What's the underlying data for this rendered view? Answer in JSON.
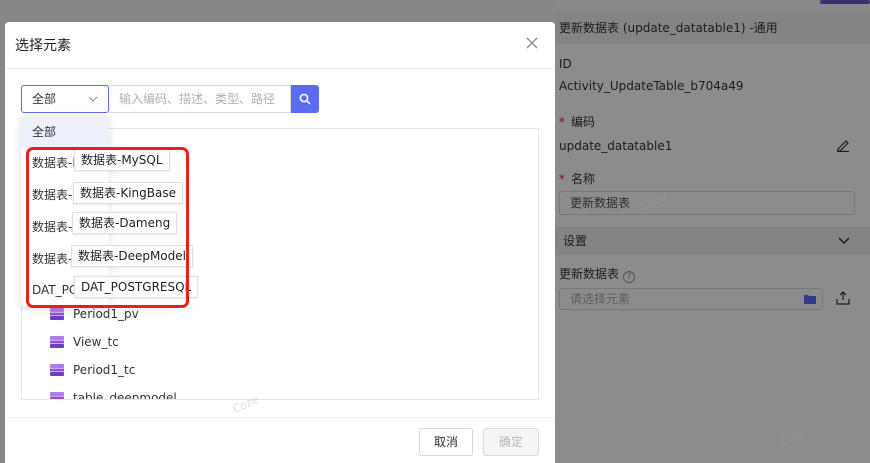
{
  "right_panel": {
    "header_title": "更新数据表 (update_datatable1) -通用",
    "id_label": "ID",
    "id_value": "Activity_UpdateTable_b704a49",
    "code_label": "编码",
    "code_value": "update_datatable1",
    "name_label": "名称",
    "name_value": "更新数据表",
    "settings_label": "设置",
    "update_table_label": "更新数据表",
    "help_glyph": "?",
    "select_placeholder": "请选择元素"
  },
  "modal": {
    "title": "选择元素",
    "filter_selected": "全部",
    "search_placeholder": "输入编码、描述、类型、路径",
    "dropdown_options": [
      "全部",
      "数据表-MySQL",
      "数据表-KingBase",
      "数据表-Dameng",
      "数据表-DeepModel",
      "DAT_POSTGRESQL"
    ],
    "tooltips": [
      "数据表-MySQL",
      "数据表-KingBase",
      "数据表-Dameng",
      "数据表-DeepModel",
      "DAT_POSTGRESQL"
    ],
    "tree_items": [
      "Period1_pv",
      "View_tc",
      "Period1_tc",
      "table_deepmodel"
    ],
    "cancel_label": "取消",
    "ok_label": "确定"
  },
  "colors": {
    "accent": "#5b6cf0",
    "annotation_red": "#ee1c1c",
    "db_icon": "#a259e0"
  },
  "watermark": "Coze"
}
